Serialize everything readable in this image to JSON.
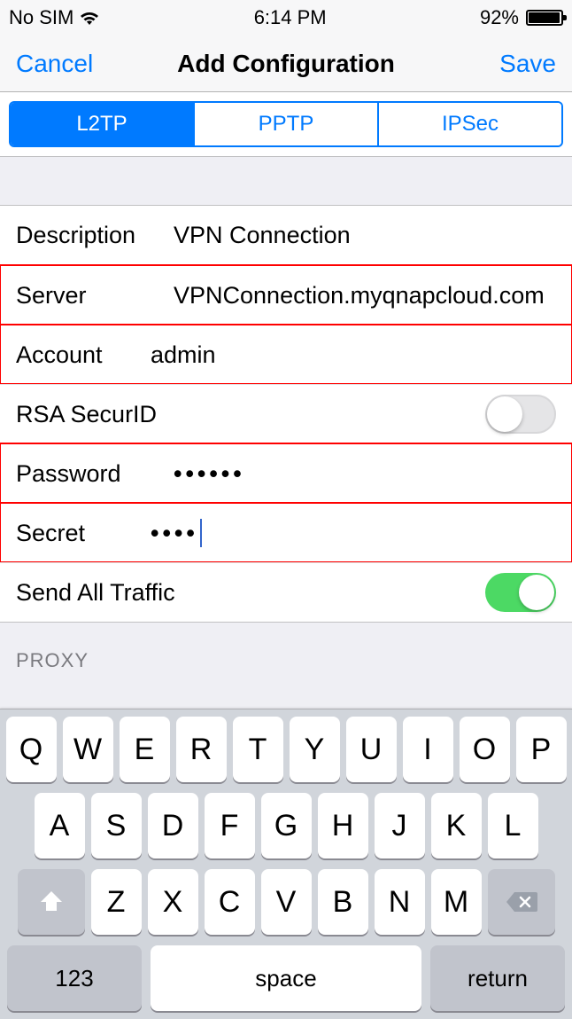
{
  "status_bar": {
    "carrier": "No SIM",
    "time": "6:14 PM",
    "battery_percent": "92%"
  },
  "nav": {
    "cancel": "Cancel",
    "title": "Add Configuration",
    "save": "Save"
  },
  "tabs": {
    "l2tp": "L2TP",
    "pptp": "PPTP",
    "ipsec": "IPSec",
    "selected": "L2TP"
  },
  "fields": {
    "description": {
      "label": "Description",
      "value": "VPN Connection"
    },
    "server": {
      "label": "Server",
      "value": "VPNConnection.myqnapcloud.com"
    },
    "account": {
      "label": "Account",
      "value": "admin"
    },
    "rsa": {
      "label": "RSA SecurID",
      "on": false
    },
    "password": {
      "label": "Password",
      "masked": "••••••"
    },
    "secret": {
      "label": "Secret",
      "masked": "••••"
    },
    "send_all": {
      "label": "Send All Traffic",
      "on": true
    }
  },
  "section": {
    "proxy": "PROXY"
  },
  "keyboard": {
    "row1": [
      "Q",
      "W",
      "E",
      "R",
      "T",
      "Y",
      "U",
      "I",
      "O",
      "P"
    ],
    "row2": [
      "A",
      "S",
      "D",
      "F",
      "G",
      "H",
      "J",
      "K",
      "L"
    ],
    "row3": [
      "Z",
      "X",
      "C",
      "V",
      "B",
      "N",
      "M"
    ],
    "number_key": "123",
    "space_key": "space",
    "return_key": "return"
  }
}
